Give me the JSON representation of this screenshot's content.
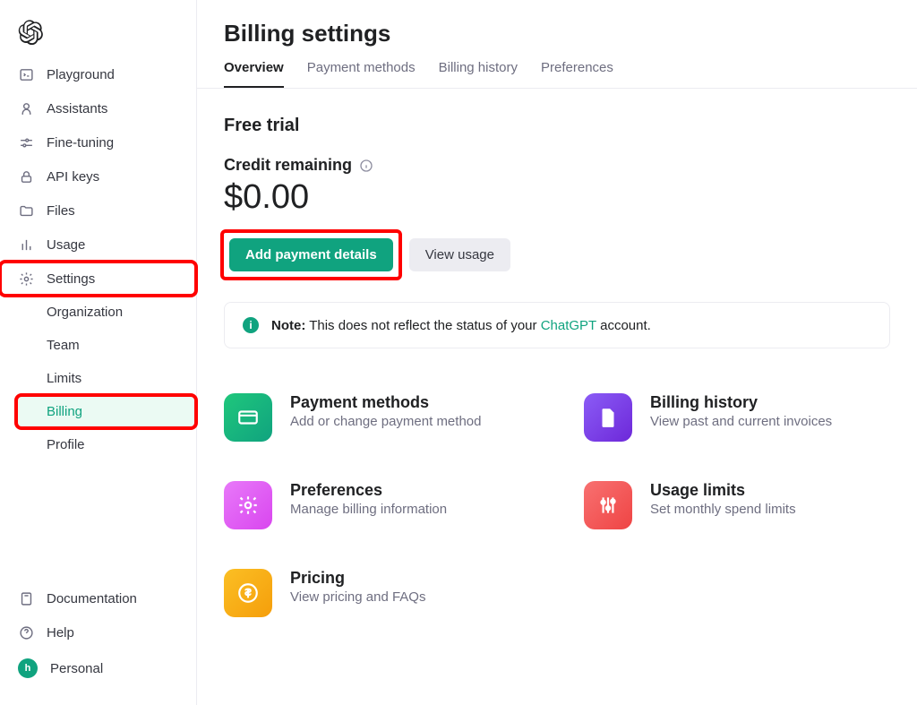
{
  "sidebar": {
    "items": [
      {
        "label": "Playground"
      },
      {
        "label": "Assistants"
      },
      {
        "label": "Fine-tuning"
      },
      {
        "label": "API keys"
      },
      {
        "label": "Files"
      },
      {
        "label": "Usage"
      },
      {
        "label": "Settings"
      }
    ],
    "settings_sub": [
      {
        "label": "Organization"
      },
      {
        "label": "Team"
      },
      {
        "label": "Limits"
      },
      {
        "label": "Billing"
      },
      {
        "label": "Profile"
      }
    ],
    "footer": {
      "documentation": "Documentation",
      "help": "Help",
      "account": "Personal",
      "account_initial": "h"
    }
  },
  "header": {
    "title": "Billing settings",
    "tabs": [
      {
        "label": "Overview"
      },
      {
        "label": "Payment methods"
      },
      {
        "label": "Billing history"
      },
      {
        "label": "Preferences"
      }
    ]
  },
  "overview": {
    "plan": "Free trial",
    "credit_label": "Credit remaining",
    "credit_amount": "$0.00",
    "add_payment_btn": "Add payment details",
    "view_usage_btn": "View usage",
    "note_prefix": "Note:",
    "note_text_before": " This does not reflect the status of your ",
    "note_link": "ChatGPT",
    "note_text_after": " account."
  },
  "cards": [
    {
      "title": "Payment methods",
      "desc": "Add or change payment method"
    },
    {
      "title": "Billing history",
      "desc": "View past and current invoices"
    },
    {
      "title": "Preferences",
      "desc": "Manage billing information"
    },
    {
      "title": "Usage limits",
      "desc": "Set monthly spend limits"
    },
    {
      "title": "Pricing",
      "desc": "View pricing and FAQs"
    }
  ]
}
